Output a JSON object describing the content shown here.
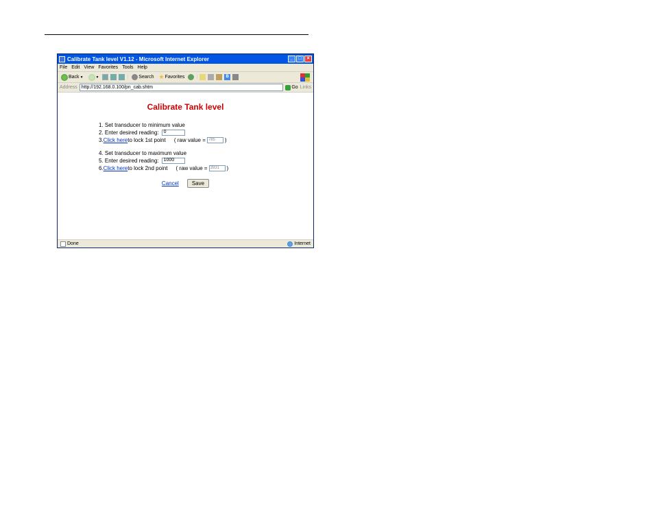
{
  "window": {
    "title": "Calibrate Tank level V1.12 - Microsoft Internet Explorer"
  },
  "menu": {
    "file": "File",
    "edit": "Edit",
    "view": "View",
    "favorites": "Favorites",
    "tools": "Tools",
    "help": "Help"
  },
  "toolbar": {
    "back": "Back",
    "search": "Search",
    "favorites": "Favorites",
    "b_label": "B"
  },
  "address": {
    "label": "Address",
    "url": "http://192.168.0.100/pn_cab.shtm",
    "go": "Go",
    "links": "Links"
  },
  "page": {
    "heading": "Calibrate Tank level"
  },
  "steps": {
    "s1": "1. Set transducer to minimum value",
    "s2": "2. Enter desired reading:",
    "s2_val": "0",
    "s3a": "3. ",
    "s3_link": "Click here",
    "s3b": " to lock 1st point",
    "s3_raw_label": "( raw value =",
    "s3_raw_val": "785",
    "s3_raw_close": ")",
    "s4": "4. Set transducer to maximum value",
    "s5": "5. Enter desired reading:",
    "s5_val": "1000",
    "s6a": "6. ",
    "s6_link": "Click here",
    "s6b": " to lock 2nd point",
    "s6_raw_label": "( raw value =",
    "s6_raw_val": "3931",
    "s6_raw_close": ")"
  },
  "actions": {
    "cancel": "Cancel",
    "save": "Save"
  },
  "status": {
    "done": "Done",
    "zone": "Internet"
  }
}
